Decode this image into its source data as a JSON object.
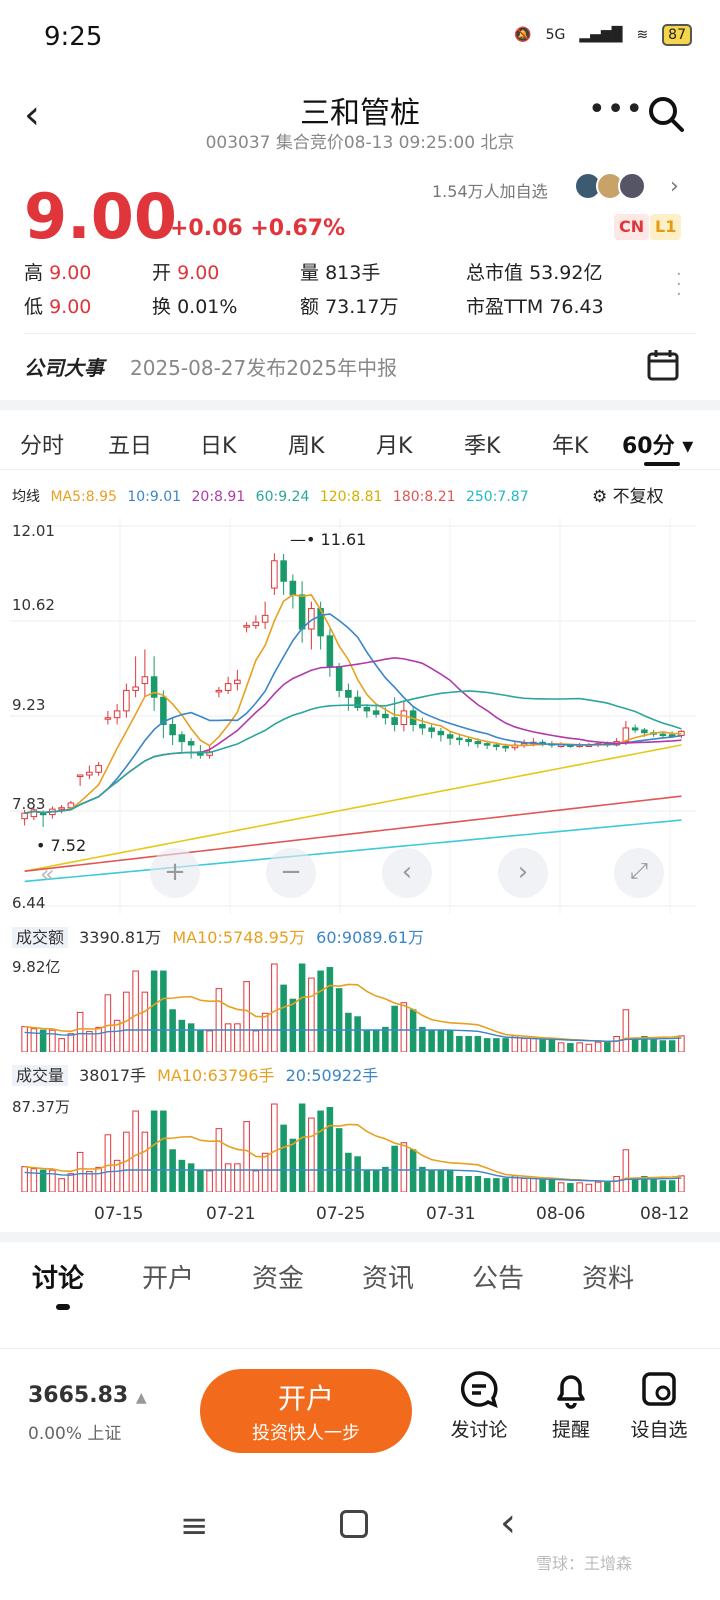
{
  "status": {
    "time": "9:25",
    "network": "5G",
    "battery": "87"
  },
  "header": {
    "title": "三和管桩",
    "subtitle": "003037 集合竞价08-13 09:25:00 北京"
  },
  "quote": {
    "price": "9.00",
    "change": "+0.06 +0.67%",
    "fans": "1.54万人加自选",
    "tag_cn": "CN",
    "tag_l1": "L1",
    "stats": [
      {
        "label": "高",
        "value": "9.00"
      },
      {
        "label": "开",
        "value": "9.00"
      },
      {
        "label": "量",
        "value": "813手"
      },
      {
        "label": "总市值",
        "value": "53.92亿"
      },
      {
        "label": "低",
        "value": "9.00"
      },
      {
        "label": "换",
        "value": "0.01%"
      },
      {
        "label": "额",
        "value": "73.17万"
      },
      {
        "label": "市盈TTM",
        "value": "76.43"
      }
    ]
  },
  "event": {
    "label": "公司大事",
    "text": "2025-08-27发布2025年中报"
  },
  "tabs": [
    "分时",
    "五日",
    "日K",
    "周K",
    "月K",
    "季K",
    "年K",
    "60分"
  ],
  "ma": {
    "label": "均线",
    "ma5": "MA5:8.95",
    "ma10": "10:9.01",
    "ma20": "20:8.91",
    "ma60": "60:9.24",
    "ma120": "120:8.81",
    "ma180": "180:8.21",
    "ma250": "250:7.87",
    "option": "不复权"
  },
  "colors": {
    "up": "#e0353b",
    "down": "#1a9a6a",
    "ma5": "#e8a020",
    "ma10": "#3a86c8",
    "ma20": "#b03aa8",
    "ma60": "#2aa69a",
    "ma120": "#e6c817",
    "ma180": "#e05656",
    "ma250": "#3ccbd8"
  },
  "chart_data": {
    "type": "candlestick",
    "ylim": [
      6.44,
      12.01
    ],
    "y_ticks": [
      "12.01",
      "10.62",
      "9.23",
      "7.83",
      "6.44"
    ],
    "high_label": "11.61",
    "low_label": "7.52",
    "x_ticks": [
      "07-15",
      "07-21",
      "07-25",
      "07-31",
      "08-06",
      "08-12"
    ],
    "candles": [
      {
        "o": 7.72,
        "c": 7.8,
        "h": 7.85,
        "l": 7.62
      },
      {
        "o": 7.75,
        "c": 7.85,
        "h": 7.88,
        "l": 7.7
      },
      {
        "o": 7.8,
        "c": 7.78,
        "h": 7.84,
        "l": 7.6
      },
      {
        "o": 7.78,
        "c": 7.86,
        "h": 7.9,
        "l": 7.72
      },
      {
        "o": 7.86,
        "c": 7.88,
        "h": 7.92,
        "l": 7.8
      },
      {
        "o": 7.88,
        "c": 7.95,
        "h": 7.98,
        "l": 7.84
      },
      {
        "o": 8.36,
        "c": 8.36,
        "h": 8.36,
        "l": 8.2
      },
      {
        "o": 8.36,
        "c": 8.4,
        "h": 8.5,
        "l": 8.3
      },
      {
        "o": 8.4,
        "c": 8.5,
        "h": 8.55,
        "l": 8.35
      },
      {
        "o": 9.2,
        "c": 9.2,
        "h": 9.3,
        "l": 9.1
      },
      {
        "o": 9.2,
        "c": 9.3,
        "h": 9.4,
        "l": 9.1
      },
      {
        "o": 9.3,
        "c": 9.6,
        "h": 9.7,
        "l": 9.2
      },
      {
        "o": 9.6,
        "c": 9.65,
        "h": 10.1,
        "l": 9.5
      },
      {
        "o": 9.7,
        "c": 9.8,
        "h": 10.2,
        "l": 9.5
      },
      {
        "o": 9.8,
        "c": 9.5,
        "h": 10.1,
        "l": 9.3
      },
      {
        "o": 9.5,
        "c": 9.1,
        "h": 9.6,
        "l": 8.9
      },
      {
        "o": 9.1,
        "c": 8.95,
        "h": 9.2,
        "l": 8.8
      },
      {
        "o": 8.95,
        "c": 8.85,
        "h": 9.0,
        "l": 8.7
      },
      {
        "o": 8.85,
        "c": 8.8,
        "h": 8.9,
        "l": 8.6
      },
      {
        "o": 8.7,
        "c": 8.65,
        "h": 8.8,
        "l": 8.6
      },
      {
        "o": 8.65,
        "c": 8.7,
        "h": 8.8,
        "l": 8.6
      },
      {
        "o": 9.6,
        "c": 9.6,
        "h": 9.65,
        "l": 9.5
      },
      {
        "o": 9.6,
        "c": 9.7,
        "h": 9.8,
        "l": 9.55
      },
      {
        "o": 9.7,
        "c": 9.75,
        "h": 9.9,
        "l": 9.6
      },
      {
        "o": 10.55,
        "c": 10.55,
        "h": 10.6,
        "l": 10.45
      },
      {
        "o": 10.55,
        "c": 10.6,
        "h": 10.7,
        "l": 10.5
      },
      {
        "o": 10.6,
        "c": 10.7,
        "h": 10.9,
        "l": 10.5
      },
      {
        "o": 11.1,
        "c": 11.5,
        "h": 11.61,
        "l": 11.0
      },
      {
        "o": 11.5,
        "c": 11.2,
        "h": 11.6,
        "l": 11.0
      },
      {
        "o": 11.2,
        "c": 11.0,
        "h": 11.3,
        "l": 10.8
      },
      {
        "o": 11.0,
        "c": 10.5,
        "h": 11.2,
        "l": 10.3
      },
      {
        "o": 10.5,
        "c": 10.8,
        "h": 10.9,
        "l": 10.2
      },
      {
        "o": 10.8,
        "c": 10.4,
        "h": 10.9,
        "l": 10.2
      },
      {
        "o": 10.4,
        "c": 9.95,
        "h": 10.5,
        "l": 9.8
      },
      {
        "o": 9.95,
        "c": 9.6,
        "h": 10.0,
        "l": 9.5
      },
      {
        "o": 9.6,
        "c": 9.5,
        "h": 9.7,
        "l": 9.3
      },
      {
        "o": 9.5,
        "c": 9.35,
        "h": 9.6,
        "l": 9.3
      },
      {
        "o": 9.35,
        "c": 9.3,
        "h": 9.4,
        "l": 9.2
      },
      {
        "o": 9.3,
        "c": 9.25,
        "h": 9.4,
        "l": 9.2
      },
      {
        "o": 9.25,
        "c": 9.2,
        "h": 9.35,
        "l": 9.1
      },
      {
        "o": 9.2,
        "c": 9.1,
        "h": 9.5,
        "l": 9.0
      },
      {
        "o": 9.1,
        "c": 9.3,
        "h": 9.45,
        "l": 9.0
      },
      {
        "o": 9.3,
        "c": 9.1,
        "h": 9.35,
        "l": 9.0
      },
      {
        "o": 9.1,
        "c": 9.05,
        "h": 9.2,
        "l": 8.95
      },
      {
        "o": 9.05,
        "c": 9.0,
        "h": 9.1,
        "l": 8.9
      },
      {
        "o": 9.0,
        "c": 8.95,
        "h": 9.05,
        "l": 8.85
      },
      {
        "o": 8.95,
        "c": 8.9,
        "h": 9.0,
        "l": 8.8
      },
      {
        "o": 8.9,
        "c": 8.88,
        "h": 8.95,
        "l": 8.8
      },
      {
        "o": 8.88,
        "c": 8.85,
        "h": 8.92,
        "l": 8.78
      },
      {
        "o": 8.85,
        "c": 8.82,
        "h": 8.9,
        "l": 8.76
      },
      {
        "o": 8.82,
        "c": 8.8,
        "h": 8.86,
        "l": 8.74
      },
      {
        "o": 8.8,
        "c": 8.78,
        "h": 8.84,
        "l": 8.72
      },
      {
        "o": 8.78,
        "c": 8.76,
        "h": 8.82,
        "l": 8.7
      },
      {
        "o": 8.76,
        "c": 8.8,
        "h": 8.86,
        "l": 8.72
      },
      {
        "o": 8.8,
        "c": 8.82,
        "h": 8.88,
        "l": 8.76
      },
      {
        "o": 8.82,
        "c": 8.84,
        "h": 8.9,
        "l": 8.78
      },
      {
        "o": 8.84,
        "c": 8.82,
        "h": 8.88,
        "l": 8.78
      },
      {
        "o": 8.82,
        "c": 8.8,
        "h": 8.86,
        "l": 8.76
      },
      {
        "o": 8.8,
        "c": 8.8,
        "h": 8.84,
        "l": 8.76
      },
      {
        "o": 8.8,
        "c": 8.79,
        "h": 8.82,
        "l": 8.76
      },
      {
        "o": 8.79,
        "c": 8.8,
        "h": 8.83,
        "l": 8.76
      },
      {
        "o": 8.8,
        "c": 8.8,
        "h": 8.83,
        "l": 8.77
      },
      {
        "o": 8.8,
        "c": 8.82,
        "h": 8.84,
        "l": 8.77
      },
      {
        "o": 8.82,
        "c": 8.8,
        "h": 8.85,
        "l": 8.77
      },
      {
        "o": 8.8,
        "c": 8.85,
        "h": 8.9,
        "l": 8.78
      },
      {
        "o": 8.85,
        "c": 9.05,
        "h": 9.15,
        "l": 8.8
      },
      {
        "o": 9.05,
        "c": 9.02,
        "h": 9.1,
        "l": 8.98
      },
      {
        "o": 9.02,
        "c": 8.98,
        "h": 9.05,
        "l": 8.92
      },
      {
        "o": 8.98,
        "c": 8.96,
        "h": 9.02,
        "l": 8.92
      },
      {
        "o": 8.96,
        "c": 8.95,
        "h": 9.0,
        "l": 8.9
      },
      {
        "o": 8.95,
        "c": 8.94,
        "h": 9.0,
        "l": 8.9
      },
      {
        "o": 8.94,
        "c": 9.0,
        "h": 9.02,
        "l": 8.9
      }
    ]
  },
  "turnover": {
    "label": "成交额",
    "value": "3390.81万",
    "ma10": "MA10:5748.95万",
    "ma60": "60:9089.61万",
    "max": "9.82亿"
  },
  "volume": {
    "label": "成交量",
    "value": "38017手",
    "ma10": "MA10:63796手",
    "ma20": "20:50922手",
    "max": "87.37万"
  },
  "bottom_tabs": [
    "讨论",
    "开户",
    "资金",
    "资讯",
    "公告",
    "资料"
  ],
  "footer": {
    "index": "3665.83",
    "index_change": "0.00% 上证",
    "open_title": "开户",
    "open_sub": "投资快人一步",
    "discuss": "发讨论",
    "remind": "提醒",
    "watch": "设自选"
  },
  "watermark": "雪球：王增森"
}
